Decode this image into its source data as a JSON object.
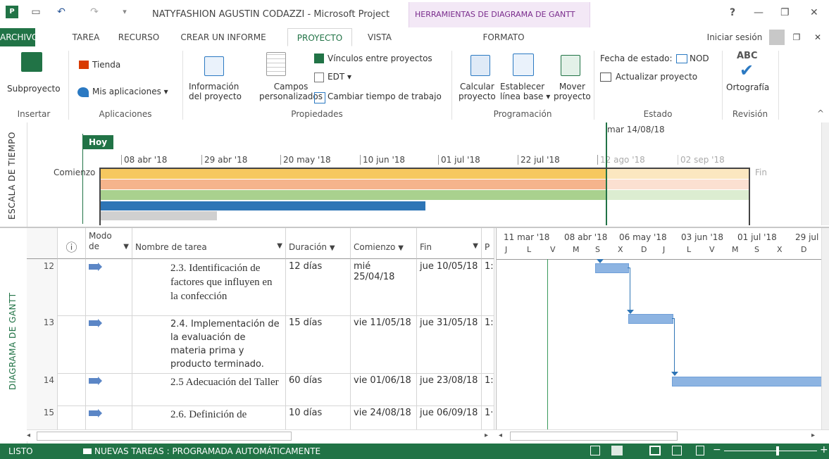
{
  "window": {
    "title": "NATYFASHION AGUSTIN CODAZZI - Microsoft Project",
    "context_tool": "HERRAMIENTAS DE DIAGRAMA DE GANTT",
    "help": "?",
    "minimize": "—",
    "restore": "❐",
    "close": "✕"
  },
  "tabs": {
    "file": "ARCHIVO",
    "task": "TAREA",
    "resource": "RECURSO",
    "report": "CREAR UN INFORME",
    "project": "PROYECTO",
    "view": "VISTA",
    "format": "FORMATO",
    "signin": "Iniciar sesión"
  },
  "ribbon": {
    "subproject": "Subproyecto",
    "store": "Tienda",
    "my_apps": "Mis aplicaciones",
    "project_info_1": "Información",
    "project_info_2": "del proyecto",
    "custom_fields_1": "Campos",
    "custom_fields_2": "personalizados",
    "links_between": "Vínculos entre proyectos",
    "wbs": "EDT",
    "change_worktime": "Cambiar tiempo de trabajo",
    "calc_1": "Calcular",
    "calc_2": "proyecto",
    "baseline_1": "Establecer",
    "baseline_2": "línea base",
    "move_1": "Mover",
    "move_2": "proyecto",
    "status_date": "Fecha de estado:",
    "status_date_value": "NOD",
    "update_project": "Actualizar proyecto",
    "spelling_abc": "ABC",
    "spelling": "Ortografía",
    "groups": {
      "insert": "Insertar",
      "apps": "Aplicaciones",
      "props": "Propiedades",
      "sched": "Programación",
      "status": "Estado",
      "review": "Revisión"
    }
  },
  "timeline": {
    "side_label": "ESCALA DE TIEMPO",
    "today": "Hoy",
    "start": "Comienzo",
    "finish": "Fin",
    "status_marker": "mar 14/08/18",
    "dates": [
      "08 abr '18",
      "29 abr '18",
      "20 may '18",
      "10 jun '18",
      "01 jul '18",
      "22 jul '18",
      "12 ago '18",
      "02 sep '18"
    ]
  },
  "gantt": {
    "side_label": "DIAGRAMA DE GANTT",
    "columns": {
      "info": "ⓘ",
      "mode_1": "Modo",
      "mode_2": "de",
      "name": "Nombre de tarea",
      "duration": "Duración",
      "start": "Comienzo",
      "finish": "Fin",
      "pred": "P"
    },
    "rows": [
      {
        "id": "12",
        "name": "2.3. Identificación de factores que influyen en la confección",
        "duration": "12 días",
        "start": "mié 25/04/18",
        "finish": "jue 10/05/18",
        "pred": "1:"
      },
      {
        "id": "13",
        "name": "2.4. Implementación de la evaluación de materia prima y producto terminado.",
        "duration": "15 días",
        "start": "vie 11/05/18",
        "finish": "jue 31/05/18",
        "pred": "1:"
      },
      {
        "id": "14",
        "name": "2.5 Adecuación del Taller",
        "duration": "60 días",
        "start": "vie 01/06/18",
        "finish": "jue 23/08/18",
        "pred": "1:"
      },
      {
        "id": "15",
        "name": "2.6. Definición de",
        "duration": "10 días",
        "start": "vie 24/08/18",
        "finish": "jue 06/09/18",
        "pred": "1·"
      }
    ],
    "chart_top": [
      "11 mar '18",
      "08 abr '18",
      "06 may '18",
      "03 jun '18",
      "01 jul '18",
      "29 jul '"
    ],
    "chart_bottom": [
      "J",
      "L",
      "V",
      "M",
      "S",
      "X",
      "D",
      "J",
      "L",
      "V",
      "M",
      "S",
      "X",
      "D"
    ]
  },
  "status": {
    "ready": "LISTO",
    "new_tasks": "NUEVAS TAREAS : PROGRAMADA AUTOMÁTICAMENTE"
  }
}
